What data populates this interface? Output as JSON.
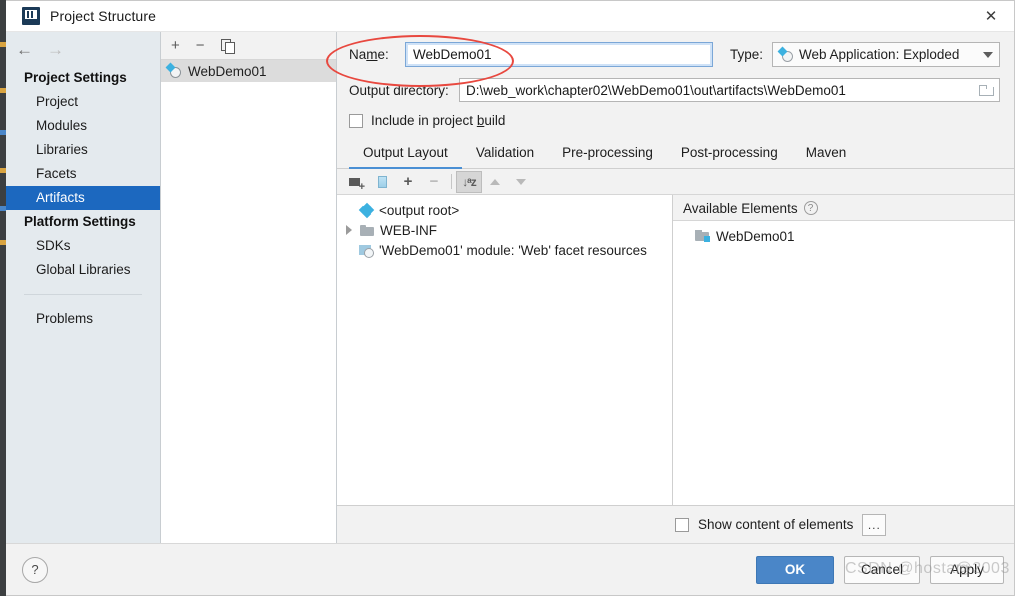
{
  "window": {
    "title": "Project Structure",
    "app_icon": "intellij-idea-icon",
    "close_label": "✕"
  },
  "sidebar": {
    "back_arrow": "←",
    "forward_arrow": "→",
    "groups": [
      {
        "title": "Project Settings",
        "items": [
          {
            "label": "Project",
            "selected": false
          },
          {
            "label": "Modules",
            "selected": false
          },
          {
            "label": "Libraries",
            "selected": false
          },
          {
            "label": "Facets",
            "selected": false
          },
          {
            "label": "Artifacts",
            "selected": true
          }
        ]
      },
      {
        "title": "Platform Settings",
        "items": [
          {
            "label": "SDKs",
            "selected": false
          },
          {
            "label": "Global Libraries",
            "selected": false
          }
        ]
      }
    ],
    "problems": {
      "label": "Problems"
    }
  },
  "artifacts_panel": {
    "toolbar": {
      "add_label": "+",
      "remove_label": "−",
      "copy_label": "copy-icon"
    },
    "items": [
      {
        "label": "WebDemo01",
        "selected": true
      }
    ]
  },
  "form": {
    "name_label_pre": "Na",
    "name_label_mnemonic": "m",
    "name_label_post": "e:",
    "name_value": "WebDemo01",
    "name_placeholder": "",
    "type_label": "Type:",
    "type_value": "Web Application: Exploded",
    "output_directory_label": "Output directory:",
    "output_directory_value": "D:\\web_work\\chapter02\\WebDemo01\\out\\artifacts\\WebDemo01",
    "output_directory_placeholder": "",
    "include_label_pre": "Include in project ",
    "include_label_mnemonic": "b",
    "include_label_post": "uild",
    "include_checked": false
  },
  "tabs": [
    {
      "label": "Output Layout",
      "active": true
    },
    {
      "label": "Validation",
      "active": false
    },
    {
      "label": "Pre-processing",
      "active": false
    },
    {
      "label": "Post-processing",
      "active": false
    },
    {
      "label": "Maven",
      "active": false
    }
  ],
  "layout_toolbar": {
    "create_directory": "folder-add-icon",
    "create_archive": "archive-icon",
    "add_copy": "plus-dropdown-icon",
    "remove": "minus-icon",
    "sort": "sort-alpha-icon",
    "move_up": "arrow-up-icon",
    "move_down": "arrow-down-icon"
  },
  "output_tree": [
    {
      "label": "<output root>",
      "icon": "artifact-root-icon",
      "indent": 0,
      "twisty": false
    },
    {
      "label": "WEB-INF",
      "icon": "folder-icon",
      "indent": 0,
      "twisty": true
    },
    {
      "label": "'WebDemo01' module: 'Web' facet resources",
      "icon": "module-facet-icon",
      "indent": 1,
      "twisty": false
    }
  ],
  "available_elements": {
    "title": "Available Elements",
    "help_glyph": "?",
    "items": [
      {
        "label": "WebDemo01",
        "icon": "module-folder-icon"
      }
    ]
  },
  "bottom_options": {
    "show_content_label": "Show content of elements",
    "show_content_checked": false,
    "more_button_label": "..."
  },
  "footer": {
    "help_label": "?",
    "ok_label": "OK",
    "cancel_label": "Cancel",
    "apply_label": "Apply"
  },
  "annotation": {
    "ellipse_color": "#e8483f"
  },
  "watermark": {
    "line_a": "CSDN @hostar",
    "line_b": "@2003"
  }
}
